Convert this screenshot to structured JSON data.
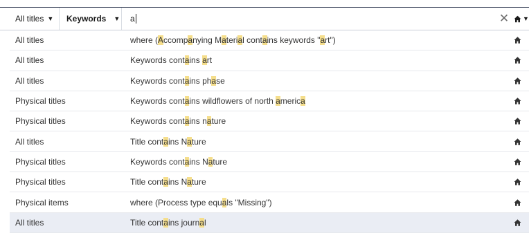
{
  "search": {
    "scope_label": "All titles",
    "field_label": "Keywords",
    "query": "a",
    "clear_symbol": "✕"
  },
  "suggestions": [
    {
      "scope": "All titles",
      "segments": [
        {
          "t": "where (",
          "h": false
        },
        {
          "t": "A",
          "h": true
        },
        {
          "t": "ccomp",
          "h": false
        },
        {
          "t": "a",
          "h": true
        },
        {
          "t": "nying M",
          "h": false
        },
        {
          "t": "a",
          "h": true
        },
        {
          "t": "teri",
          "h": false
        },
        {
          "t": "a",
          "h": true
        },
        {
          "t": "l cont",
          "h": false
        },
        {
          "t": "a",
          "h": true
        },
        {
          "t": "ins keywords \"",
          "h": false
        },
        {
          "t": "a",
          "h": true
        },
        {
          "t": "rt\")",
          "h": false
        }
      ]
    },
    {
      "scope": "All titles",
      "segments": [
        {
          "t": "Keywords cont",
          "h": false
        },
        {
          "t": "a",
          "h": true
        },
        {
          "t": "ins ",
          "h": false
        },
        {
          "t": "a",
          "h": true
        },
        {
          "t": "rt",
          "h": false
        }
      ]
    },
    {
      "scope": "All titles",
      "segments": [
        {
          "t": "Keywords cont",
          "h": false
        },
        {
          "t": "a",
          "h": true
        },
        {
          "t": "ins ph",
          "h": false
        },
        {
          "t": "a",
          "h": true
        },
        {
          "t": "se",
          "h": false
        }
      ]
    },
    {
      "scope": "Physical titles",
      "segments": [
        {
          "t": "Keywords cont",
          "h": false
        },
        {
          "t": "a",
          "h": true
        },
        {
          "t": "ins wildflowers of north ",
          "h": false
        },
        {
          "t": "a",
          "h": true
        },
        {
          "t": "meric",
          "h": false
        },
        {
          "t": "a",
          "h": true
        }
      ]
    },
    {
      "scope": "Physical titles",
      "segments": [
        {
          "t": "Keywords cont",
          "h": false
        },
        {
          "t": "a",
          "h": true
        },
        {
          "t": "ins n",
          "h": false
        },
        {
          "t": "a",
          "h": true
        },
        {
          "t": "ture",
          "h": false
        }
      ]
    },
    {
      "scope": "All titles",
      "segments": [
        {
          "t": "Title cont",
          "h": false
        },
        {
          "t": "a",
          "h": true
        },
        {
          "t": "ins N",
          "h": false
        },
        {
          "t": "a",
          "h": true
        },
        {
          "t": "ture",
          "h": false
        }
      ]
    },
    {
      "scope": "Physical titles",
      "segments": [
        {
          "t": "Keywords cont",
          "h": false
        },
        {
          "t": "a",
          "h": true
        },
        {
          "t": "ins N",
          "h": false
        },
        {
          "t": "a",
          "h": true
        },
        {
          "t": "ture",
          "h": false
        }
      ]
    },
    {
      "scope": "Physical titles",
      "segments": [
        {
          "t": "Title cont",
          "h": false
        },
        {
          "t": "a",
          "h": true
        },
        {
          "t": "ins N",
          "h": false
        },
        {
          "t": "a",
          "h": true
        },
        {
          "t": "ture",
          "h": false
        }
      ]
    },
    {
      "scope": "Physical items",
      "segments": [
        {
          "t": "where (Process type equ",
          "h": false
        },
        {
          "t": "a",
          "h": true
        },
        {
          "t": "ls \"Missing\")",
          "h": false
        }
      ]
    },
    {
      "scope": "All titles",
      "selected": true,
      "segments": [
        {
          "t": "Title cont",
          "h": false
        },
        {
          "t": "a",
          "h": true
        },
        {
          "t": "ins journ",
          "h": false
        },
        {
          "t": "a",
          "h": true
        },
        {
          "t": "l",
          "h": false
        }
      ]
    }
  ],
  "icons": {
    "home": "home-icon",
    "dropdown": "caret-down-icon",
    "clear": "close-icon"
  },
  "colors": {
    "highlight": "#f5de8c",
    "selected_row": "#eaedf4",
    "border_top": "#1f2a44"
  }
}
